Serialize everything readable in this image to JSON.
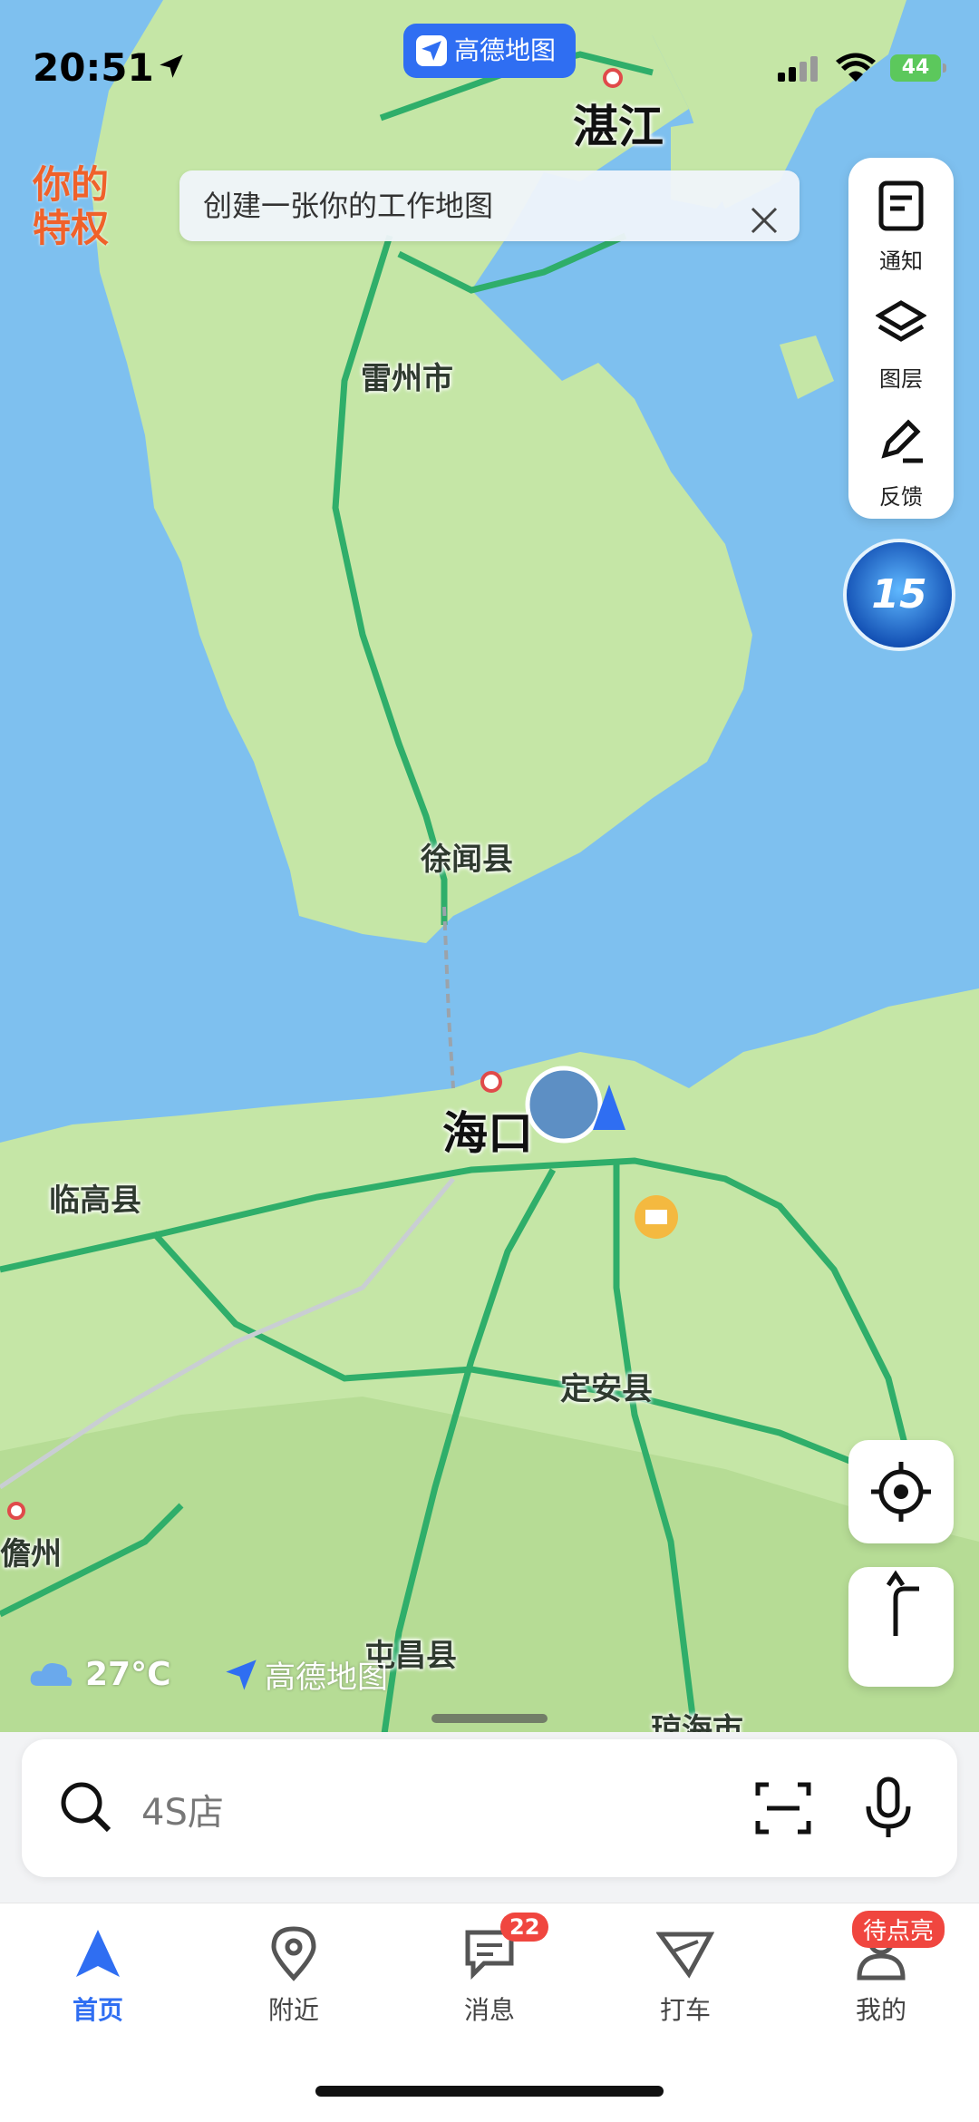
{
  "status_bar": {
    "time": "20:51",
    "battery": "44"
  },
  "brand": {
    "name": "高德地图"
  },
  "privilege": {
    "text": "你的特权"
  },
  "banner": {
    "text": "创建一张你的工作地图"
  },
  "tools": [
    {
      "label": "通知",
      "icon": "notice-icon"
    },
    {
      "label": "图层",
      "icon": "layers-icon"
    },
    {
      "label": "反馈",
      "icon": "feedback-icon"
    }
  ],
  "badge": {
    "text": "15"
  },
  "map": {
    "places": [
      {
        "key": "zhanjiang",
        "name": "湛江"
      },
      {
        "key": "leizhou",
        "name": "雷州市"
      },
      {
        "key": "xuwen",
        "name": "徐闻县"
      },
      {
        "key": "haikou",
        "name": "海口"
      },
      {
        "key": "lingao",
        "name": "临高县"
      },
      {
        "key": "dingan",
        "name": "定安县"
      },
      {
        "key": "danzhou",
        "name": "儋州"
      },
      {
        "key": "tunchang",
        "name": "屯昌县"
      },
      {
        "key": "qionghai",
        "name": "琼海市"
      }
    ]
  },
  "route_button": {
    "label": "路线"
  },
  "weather": {
    "temperature": "27°C",
    "icon": "cloud-icon"
  },
  "watermark": {
    "text": "高德地图"
  },
  "search": {
    "placeholder": "4S店"
  },
  "tabs": [
    {
      "label": "首页",
      "active": true
    },
    {
      "label": "附近"
    },
    {
      "label": "消息",
      "badge": "22"
    },
    {
      "label": "打车"
    },
    {
      "label": "我的",
      "badge": "待点亮"
    }
  ],
  "colors": {
    "sea": "#7ec0ef",
    "land": "#c5e6a6",
    "road": "#2fae6a",
    "accent": "#2f6ef2",
    "badge": "#f0463f"
  }
}
